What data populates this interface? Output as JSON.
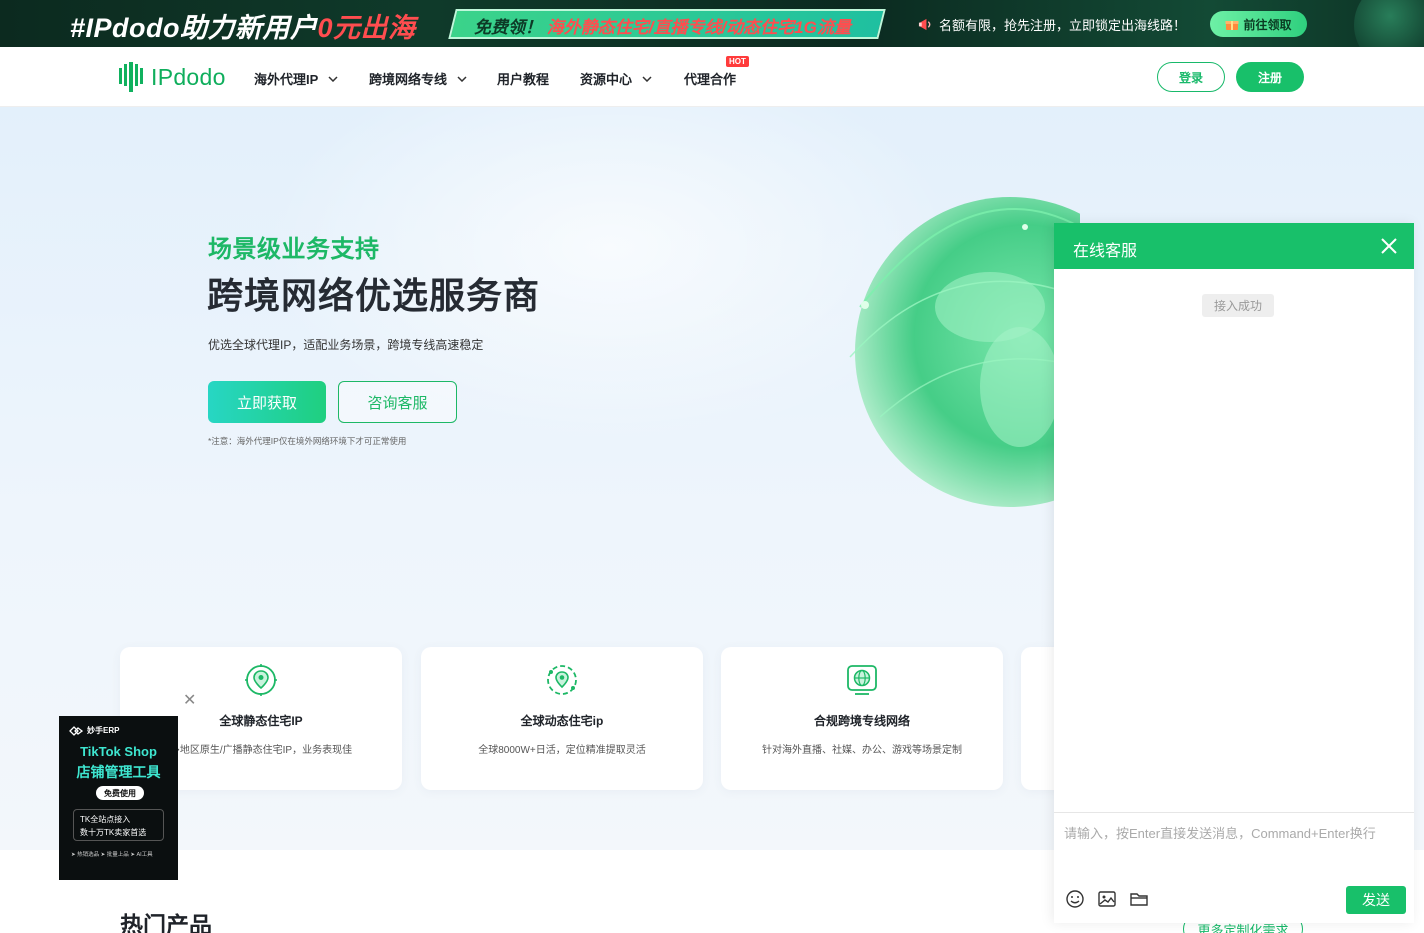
{
  "promo": {
    "title_prefix": "#IPdodo助力新用户",
    "title_highlight": "0元出海",
    "strip_prefix": "免费领！",
    "strip_highlight": "海外静态住宅/直播专线/动态住宅1G流量",
    "note": "名额有限，抢先注册，立即锁定出海线路！",
    "button": "前往领取"
  },
  "nav": {
    "logo": "IPdodo",
    "items": [
      {
        "label": "海外代理IP",
        "has_dropdown": true
      },
      {
        "label": "跨境网络专线",
        "has_dropdown": true
      },
      {
        "label": "用户教程",
        "has_dropdown": false
      },
      {
        "label": "资源中心",
        "has_dropdown": true
      },
      {
        "label": "代理合作",
        "has_dropdown": false
      }
    ],
    "hot_badge": "HOT",
    "login": "登录",
    "register": "注册"
  },
  "hero": {
    "subtitle": "场景级业务支持",
    "title": "跨境网络优选服务商",
    "desc": "优选全球代理IP，适配业务场景，跨境专线高速稳定",
    "primary_button": "立即获取",
    "secondary_button": "咨询客服",
    "note": "*注意：海外代理IP仅在境外网络环境下才可正常使用"
  },
  "cards": [
    {
      "title": "全球静态住宅IP",
      "desc": "多地区原生/广播静态住宅IP，业务表现佳",
      "icon": "location-pin-icon"
    },
    {
      "title": "全球动态住宅ip",
      "desc": "全球8000W+日活，定位精准提取灵活",
      "icon": "dynamic-location-icon"
    },
    {
      "title": "合规跨境专线网络",
      "desc": "针对海外直播、社媒、办公、游戏等场景定制",
      "icon": "globe-line-icon"
    }
  ],
  "section": {
    "title": "热门产品",
    "more": "更多定制化需求"
  },
  "ad": {
    "brand": "妙手ERP",
    "line1": "TikTok Shop",
    "line2": "店铺管理工具",
    "free": "免费使用",
    "box_line1": "TK全站点接入",
    "box_line2": "数十万TK卖家首选",
    "footer": "➤ 热销选品  ➤ 批量上品  ➤ AI工具"
  },
  "chat": {
    "title": "在线客服",
    "status": "接入成功",
    "placeholder": "请输入，按Enter直接发送消息，Command+Enter换行",
    "send": "发送"
  },
  "colors": {
    "brand_green": "#18c06a",
    "hero_green": "#1db866",
    "promo_dark": "#0c2a1f",
    "hot_red": "#ff3b3b"
  }
}
